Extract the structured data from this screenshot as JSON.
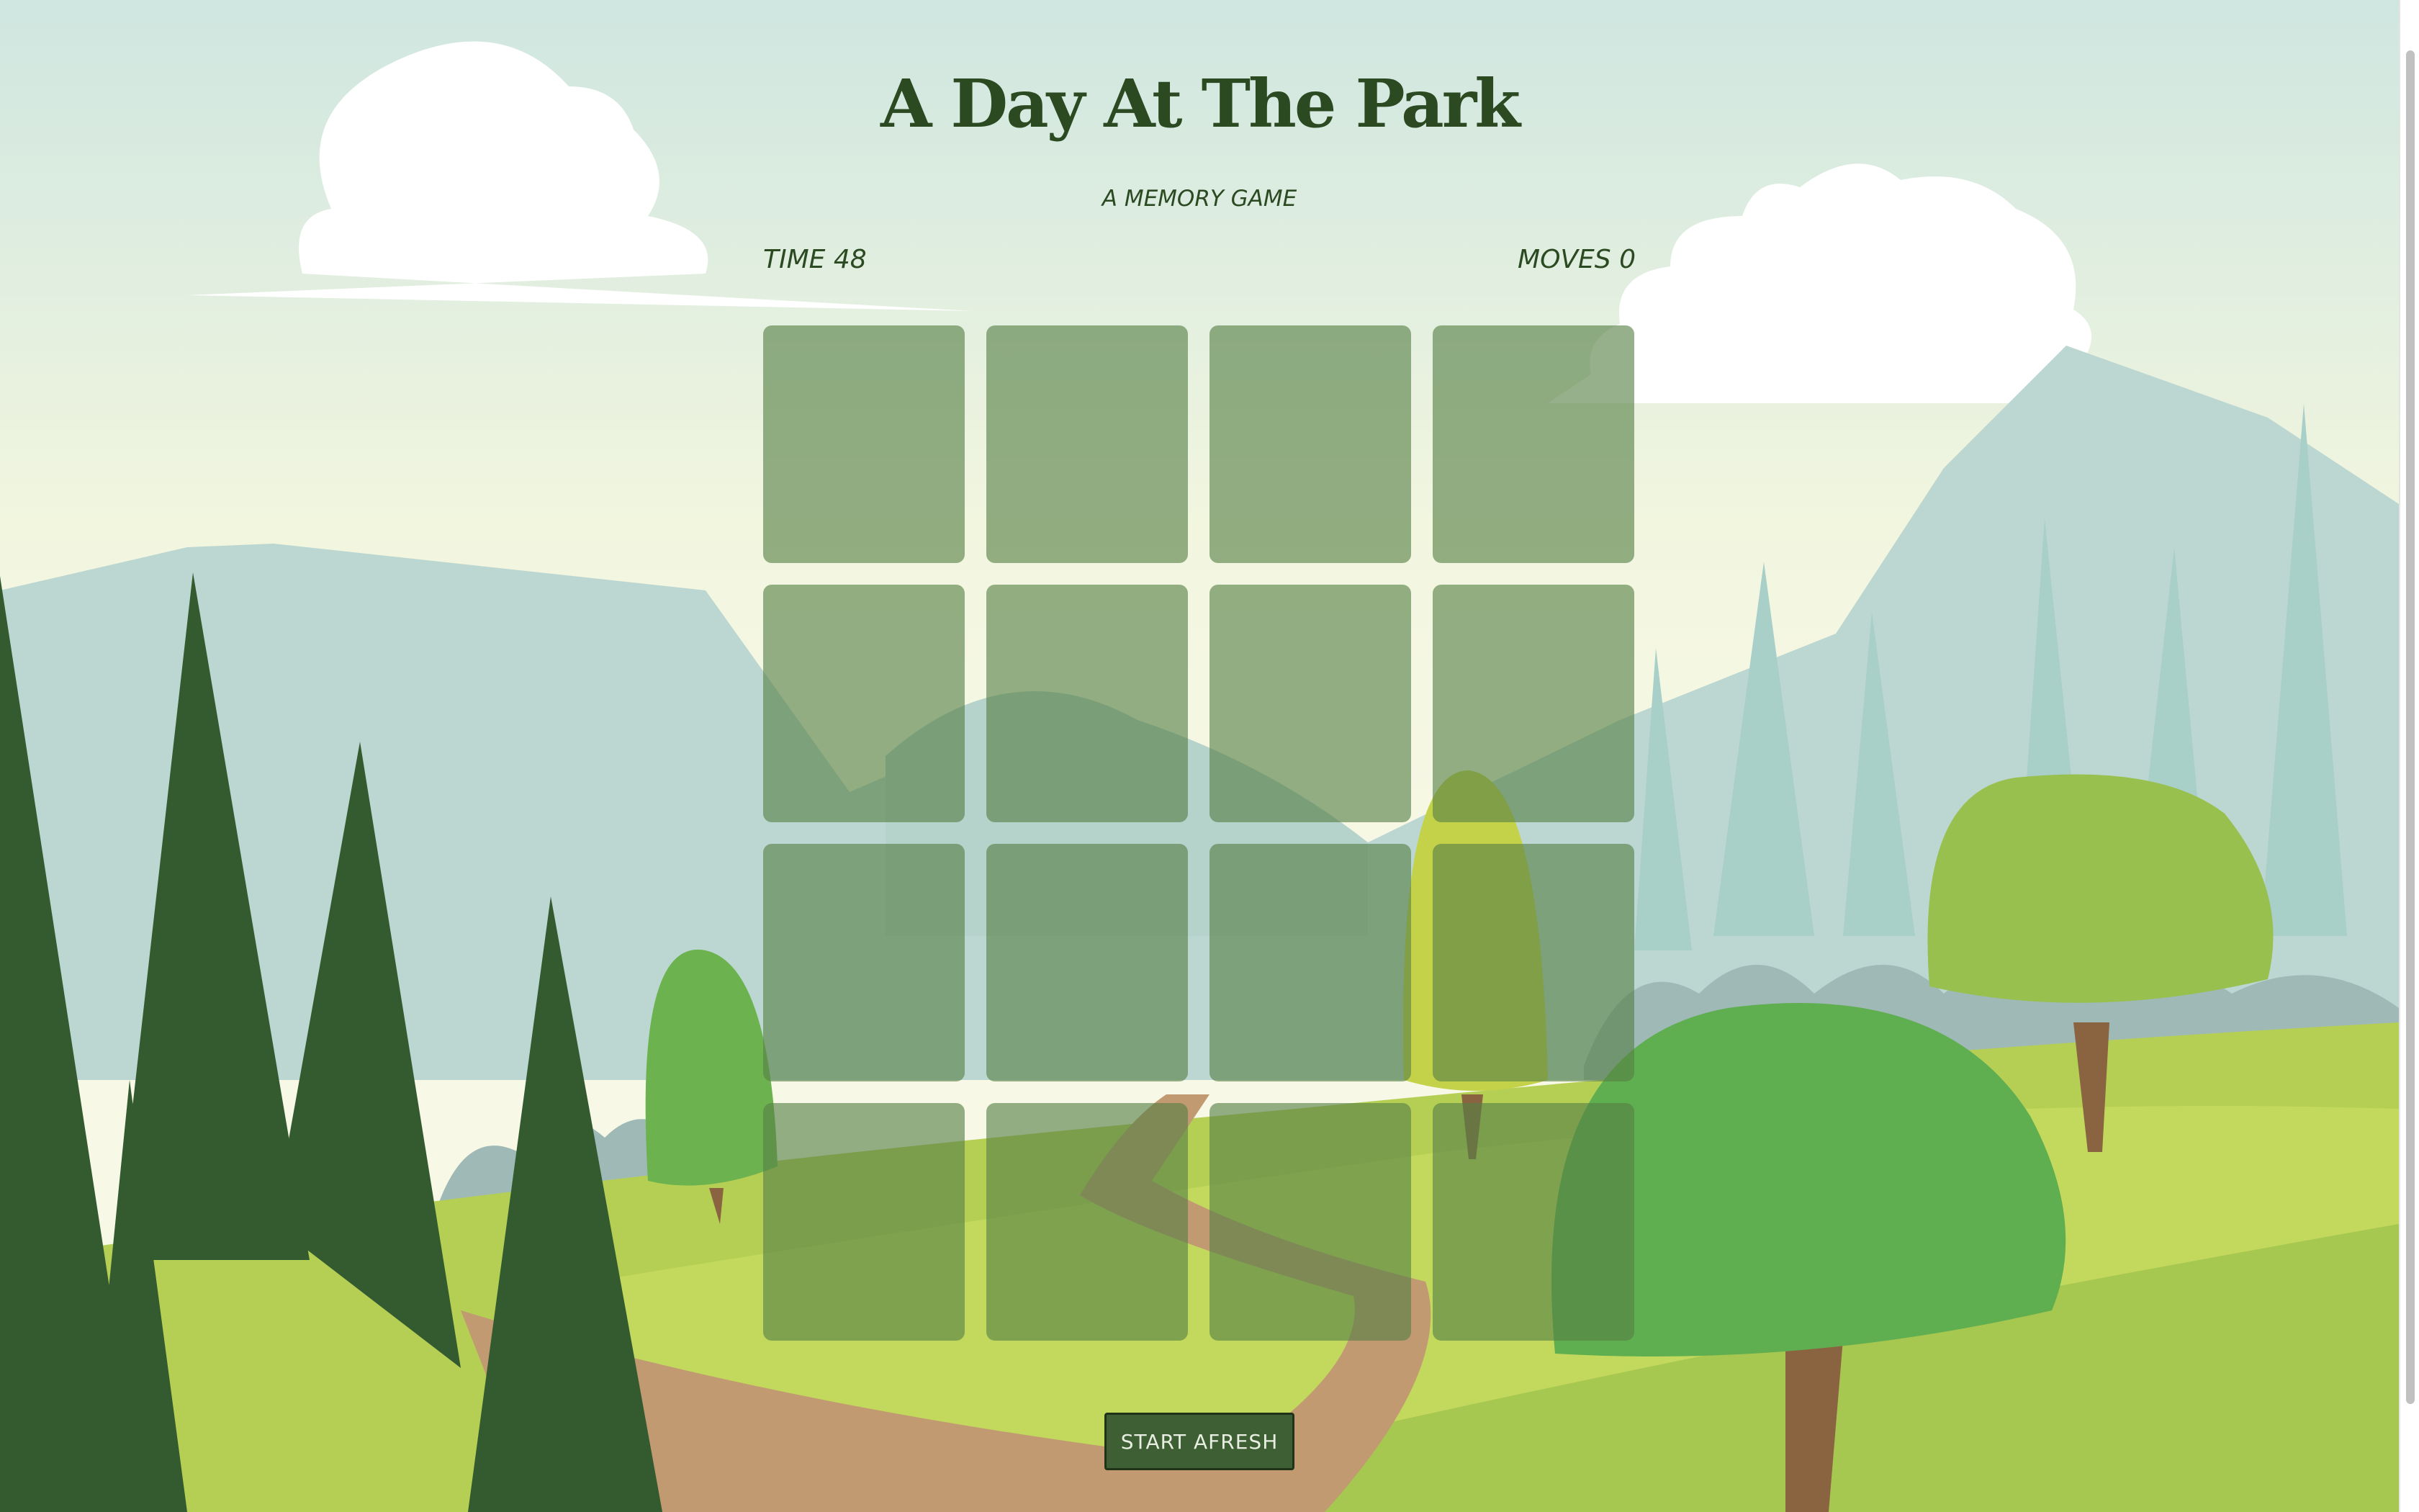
{
  "game": {
    "title": "A Day At The Park",
    "subtitle": "A MEMORY GAME",
    "time_label": "TIME 48",
    "moves_label": "MOVES 0",
    "restart_label": "START AFRESH",
    "cards_face_down": 16,
    "grid_rows": 4,
    "grid_cols": 4
  },
  "colors": {
    "title_text": "#2c4a22",
    "card_back": "#5a8048",
    "button_bg": "#3e5e34",
    "button_text": "#e8efe2",
    "sky_top": "#cfe6e0",
    "sky_bottom": "#f7f8e6",
    "dark_pine": "#345b2f",
    "grass": "#b5cf55",
    "path": "#c19a72"
  },
  "icons": [
    "cloud-icon",
    "pine-tree-icon",
    "round-tree-icon",
    "mountain-icon"
  ]
}
